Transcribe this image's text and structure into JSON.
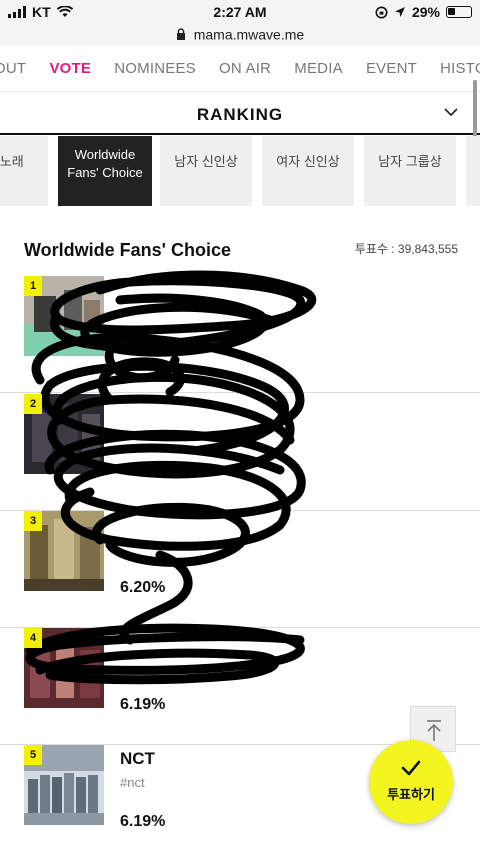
{
  "status_bar": {
    "carrier": "KT",
    "time": "2:27 AM",
    "battery": "29%"
  },
  "browser": {
    "url": "mama.mwave.me"
  },
  "nav": {
    "items": [
      "OUT",
      "VOTE",
      "NOMINEES",
      "ON AIR",
      "MEDIA",
      "EVENT",
      "HISTORY"
    ],
    "active": "VOTE"
  },
  "section": {
    "title": "RANKING"
  },
  "categories": [
    {
      "label": "의 노래"
    },
    {
      "label": "Worldwide Fans' Choice"
    },
    {
      "label": "남자 신인상"
    },
    {
      "label": "여자 신인상"
    },
    {
      "label": "남자 그룹상"
    }
  ],
  "list": {
    "title": "Worldwide Fans' Choice",
    "votes": "투표수 : 39,843,555",
    "rows": [
      {
        "rank": "1",
        "artist": "",
        "tag": "",
        "percent": ""
      },
      {
        "rank": "2",
        "artist": "",
        "tag": "",
        "percent": ""
      },
      {
        "rank": "3",
        "artist": "",
        "tag": "",
        "percent": "6.20%"
      },
      {
        "rank": "4",
        "artist": "",
        "tag": "",
        "percent": "6.19%"
      },
      {
        "rank": "5",
        "artist": "NCT",
        "tag": "#nct",
        "percent": "6.19%"
      }
    ]
  },
  "vote_button": {
    "label": "투표하기"
  },
  "colors": {
    "accent": "#e6187c",
    "badge": "#f3f000",
    "vote_button": "#f2f51f"
  }
}
